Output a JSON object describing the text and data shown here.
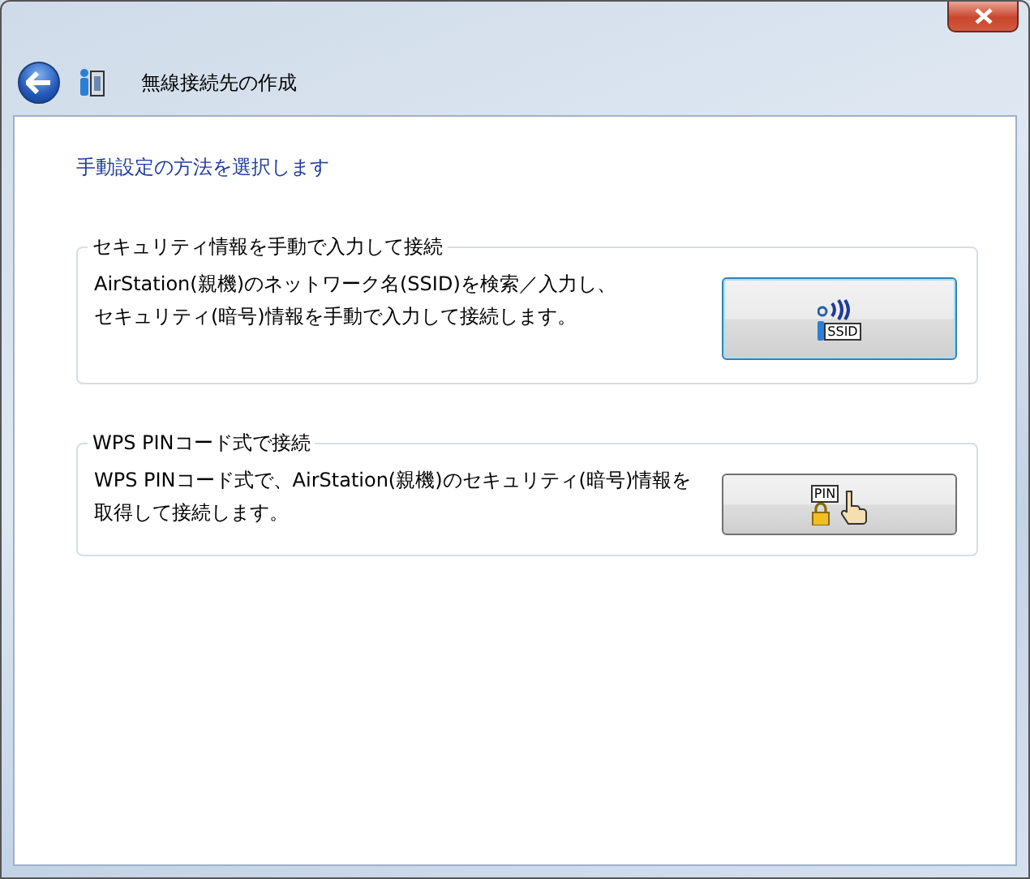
{
  "window": {
    "title": "無線接続先の作成"
  },
  "heading": "手動設定の方法を選択します",
  "options": [
    {
      "legend": "セキュリティ情報を手動で入力して接続",
      "description_lines": [
        "AirStation(親機)のネットワーク名(SSID)を検索／入力し、",
        "セキュリティ(暗号)情報を手動で入力して接続します。"
      ],
      "kind": "ssid",
      "icon_label": "SSID",
      "focused": true
    },
    {
      "legend": "WPS PINコード式で接続",
      "description_lines": [
        "WPS PINコード式で、AirStation(親機)のセキュリティ(暗号)情報を",
        "取得して接続します。"
      ],
      "kind": "pin",
      "icon_label": "PIN",
      "focused": false
    }
  ]
}
